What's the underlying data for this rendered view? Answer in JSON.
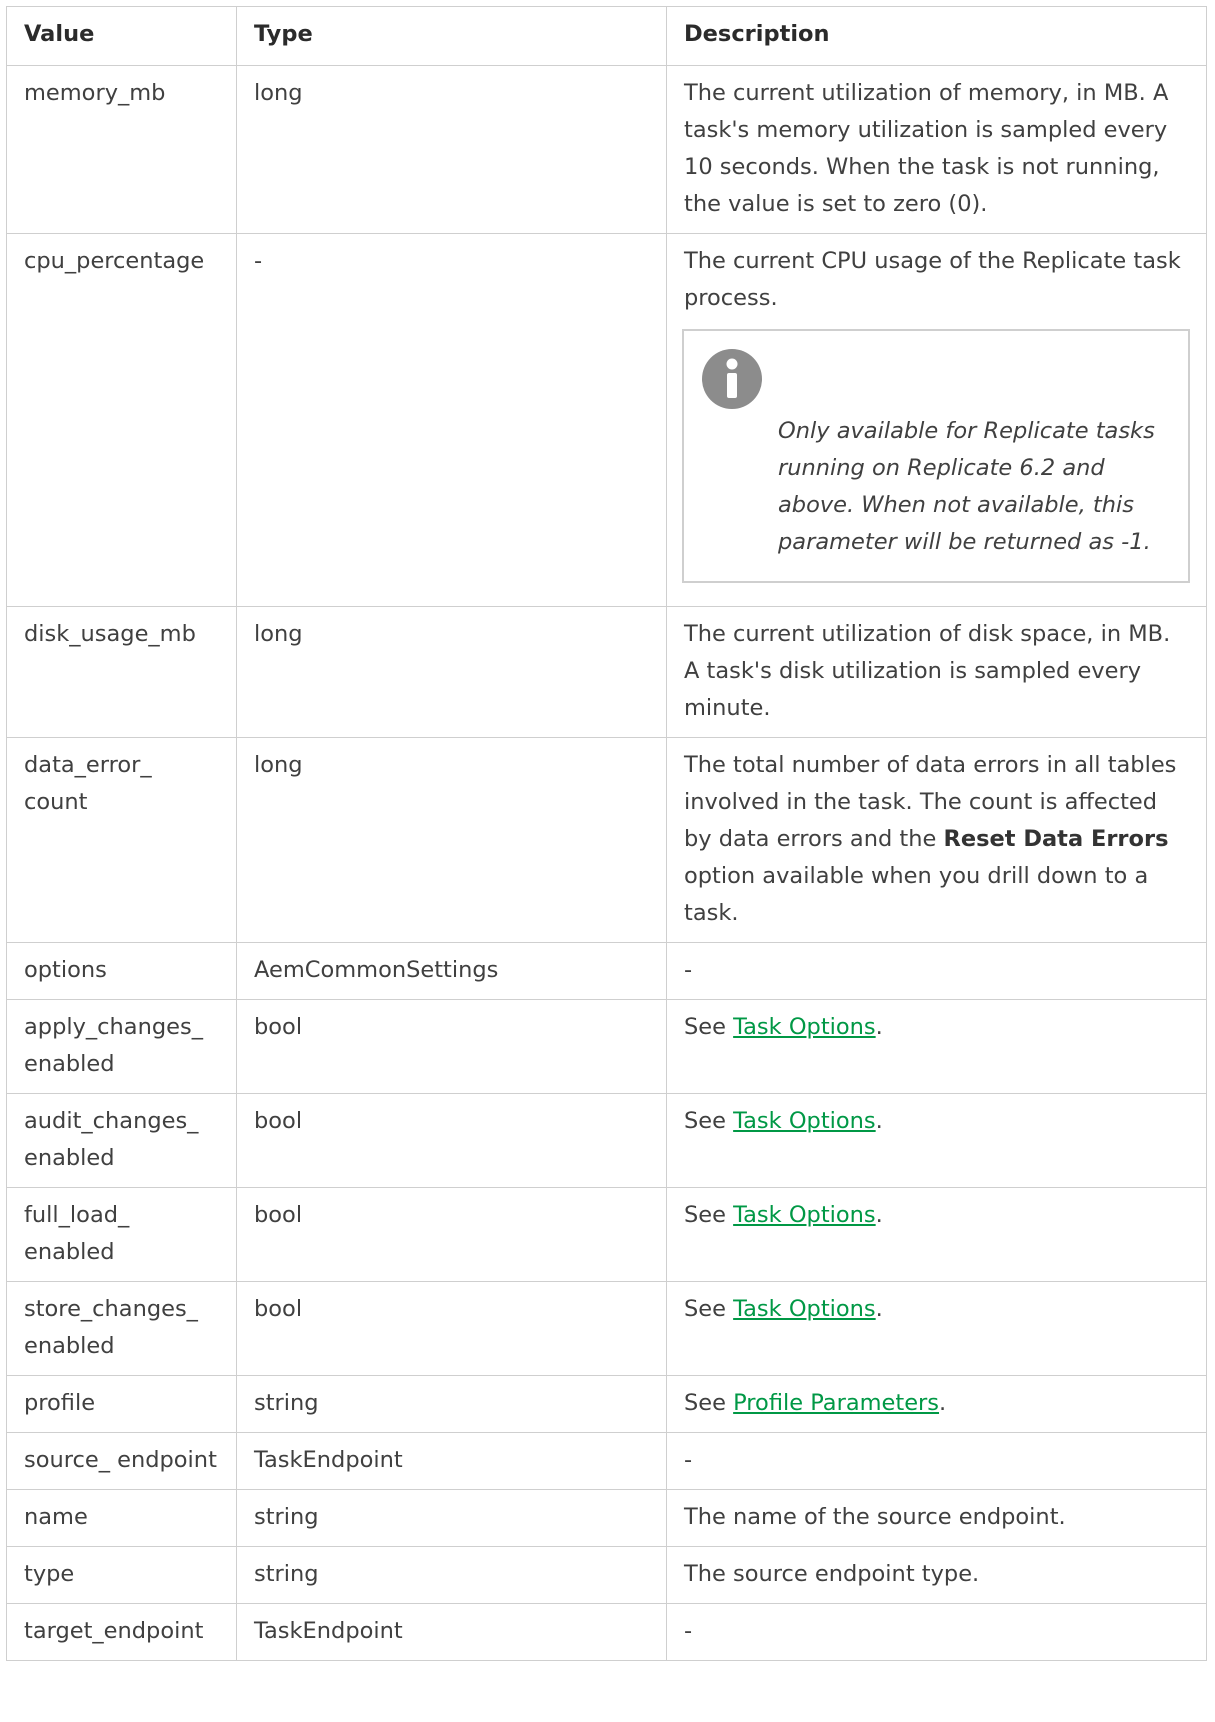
{
  "headers": {
    "value": "Value",
    "type": "Type",
    "description": "Description"
  },
  "rows": [
    {
      "value": "memory_mb",
      "type": "long",
      "description": "The current utilization of memory, in MB. A task's memory utilization is sampled every 10 seconds. When the task is not running, the value is set to zero (0)."
    },
    {
      "value": "cpu_percentage",
      "type": "-",
      "description": "The current CPU usage of the Replicate task process.",
      "note": {
        "icon": "info-icon",
        "text": "Only available for Replicate tasks running on Replicate 6.2 and above. When not available, this parameter will be returned as -1."
      }
    },
    {
      "value": "disk_usage_mb",
      "type": "long",
      "description": "The current utilization of disk space, in MB. A task's disk utilization is sampled every minute."
    },
    {
      "value": "data_error_ count",
      "type": "long",
      "description_parts": [
        "The total number of data errors in all tables involved in the task. The count is affected by data errors and the ",
        "Reset Data Errors",
        " option available when you drill down to a task."
      ]
    },
    {
      "value": "options",
      "type": "AemCommonSettings",
      "description": "-"
    },
    {
      "value": "apply_changes_ enabled",
      "type": "bool",
      "see": {
        "prefix": "See ",
        "link": "Task Options",
        "suffix": "."
      }
    },
    {
      "value": "audit_changes_ enabled",
      "type": "bool",
      "see": {
        "prefix": "See ",
        "link": "Task Options",
        "suffix": "."
      }
    },
    {
      "value": "full_load_ enabled",
      "type": "bool",
      "see": {
        "prefix": "See ",
        "link": "Task Options",
        "suffix": "."
      }
    },
    {
      "value": "store_changes_ enabled",
      "type": "bool",
      "see": {
        "prefix": "See ",
        "link": "Task Options",
        "suffix": "."
      }
    },
    {
      "value": "profile",
      "type": "string",
      "see": {
        "prefix": "See ",
        "link": "Profile Parameters",
        "suffix": "."
      }
    },
    {
      "value": "source_ endpoint",
      "type": "TaskEndpoint",
      "description": "-"
    },
    {
      "value": "name",
      "type": "string",
      "description": "The name of the source endpoint."
    },
    {
      "value": "type",
      "type": "string",
      "description": "The source endpoint type."
    },
    {
      "value": "target_endpoint",
      "type": "TaskEndpoint",
      "description": "-"
    }
  ],
  "colors": {
    "link": "#009845",
    "border": "#cfcfcf",
    "icon": "#8c8c8c"
  }
}
